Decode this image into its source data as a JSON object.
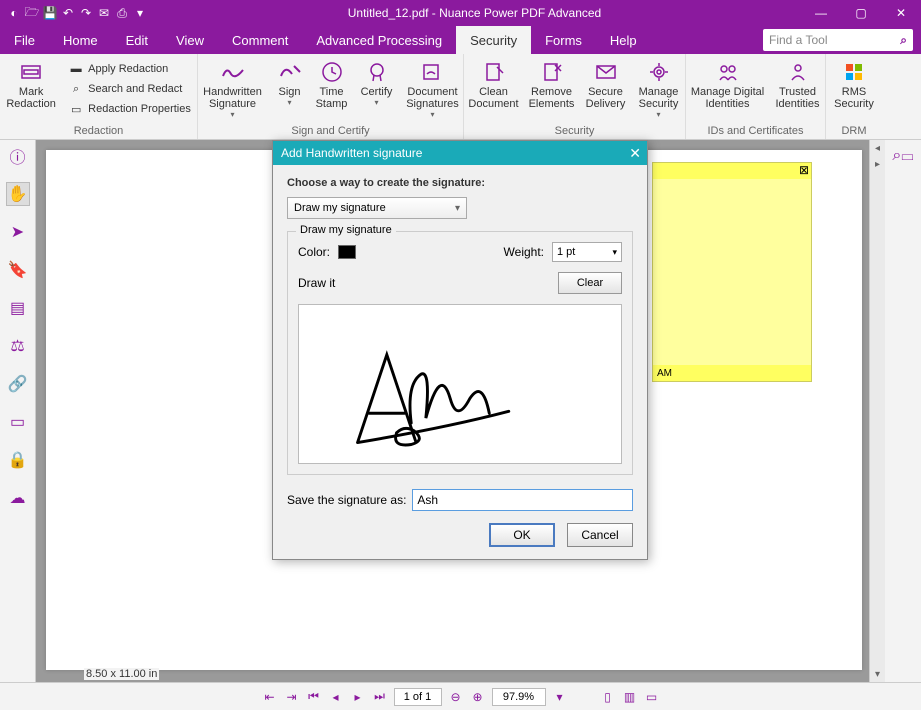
{
  "title": "Untitled_12.pdf - Nuance Power PDF Advanced",
  "menu": {
    "file": "File",
    "home": "Home",
    "edit": "Edit",
    "view": "View",
    "comment": "Comment",
    "advanced": "Advanced Processing",
    "security": "Security",
    "forms": "Forms",
    "help": "Help"
  },
  "find_placeholder": "Find a Tool",
  "ribbon": {
    "redaction": {
      "label": "Redaction",
      "mark": "Mark\nRedaction",
      "apply": "Apply Redaction",
      "search": "Search and Redact",
      "props": "Redaction Properties"
    },
    "sign": {
      "label": "Sign and Certify",
      "handwritten": "Handwritten\nSignature",
      "sign": "Sign",
      "timestamp": "Time\nStamp",
      "certify": "Certify",
      "docsigs": "Document\nSignatures"
    },
    "security": {
      "label": "Security",
      "clean": "Clean\nDocument",
      "remove": "Remove\nElements",
      "secure": "Secure\nDelivery",
      "manage": "Manage\nSecurity"
    },
    "ids": {
      "label": "IDs and Certificates",
      "digital": "Manage Digital\nIdentities",
      "trusted": "Trusted\nIdentities"
    },
    "drm": {
      "label": "DRM",
      "rms": "RMS\nSecurity"
    }
  },
  "sticky_note_time": "AM",
  "page_size": "8.50 x 11.00 in",
  "statusbar": {
    "page": "1 of 1",
    "zoom": "97.9%"
  },
  "dialog": {
    "title": "Add Handwritten signature",
    "choose_label": "Choose a way to create the signature:",
    "method": "Draw my signature",
    "groupbox_title": "Draw my signature",
    "color_label": "Color:",
    "weight_label": "Weight:",
    "weight_value": "1 pt",
    "drawit_label": "Draw it",
    "clear": "Clear",
    "save_label": "Save the signature as:",
    "save_value": "Ash",
    "ok": "OK",
    "cancel": "Cancel"
  }
}
